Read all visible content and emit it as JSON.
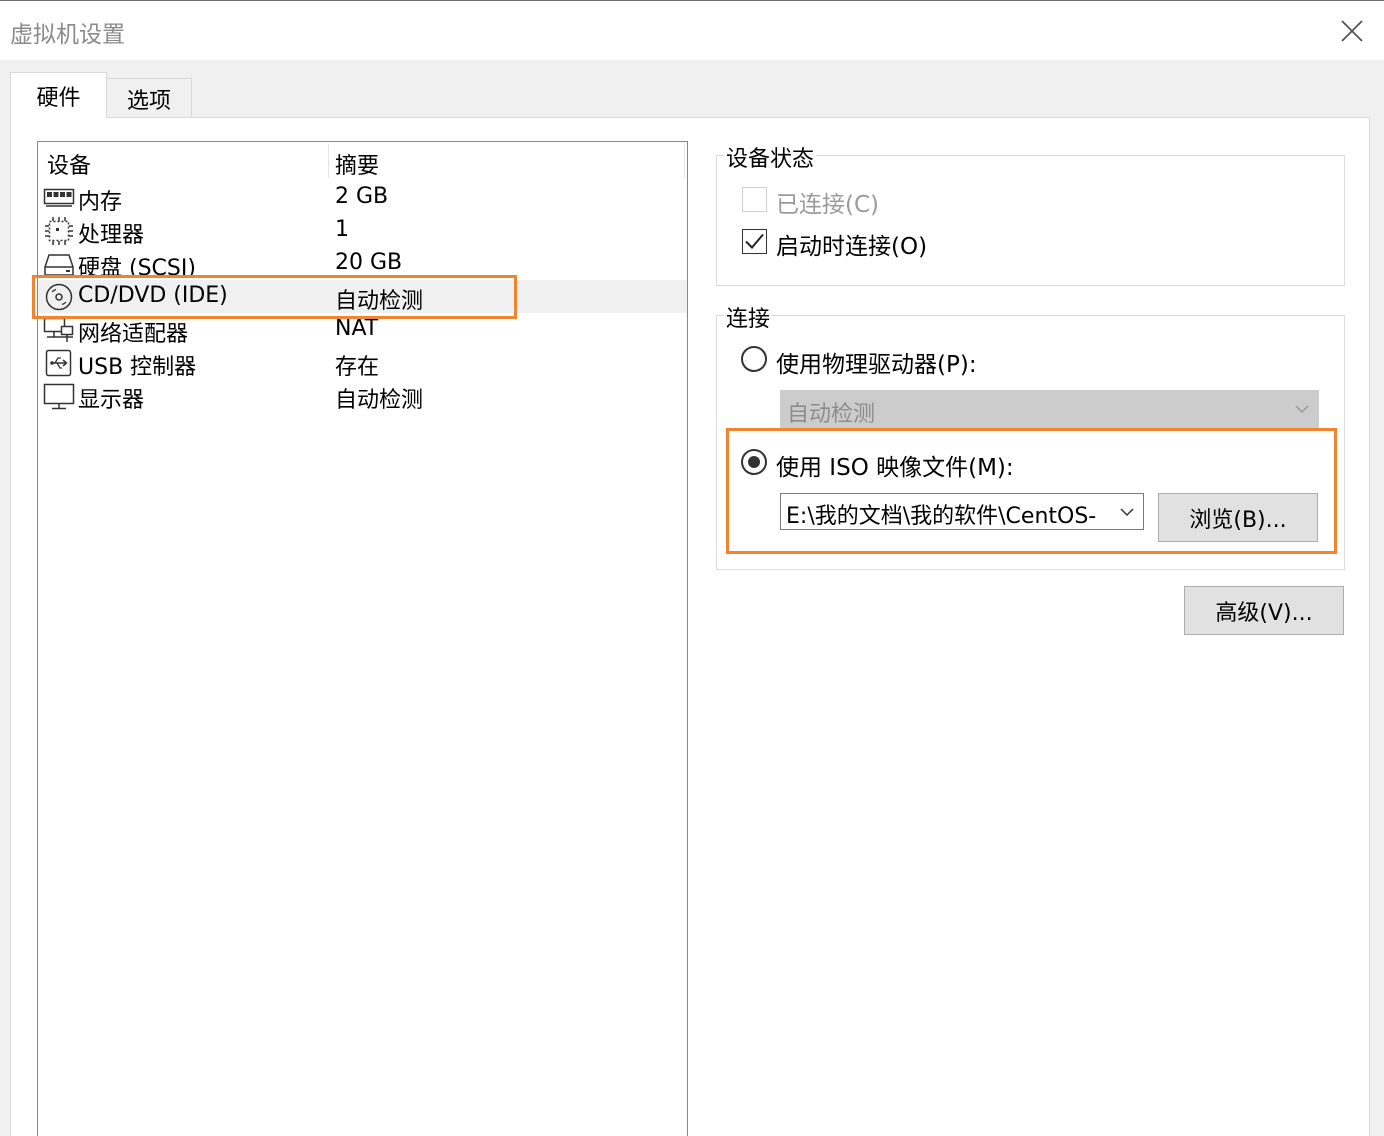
{
  "window": {
    "title": "虚拟机设置"
  },
  "tabs": [
    {
      "label": "硬件",
      "active": true
    },
    {
      "label": "选项",
      "active": false
    }
  ],
  "device_list": {
    "headers": {
      "device": "设备",
      "summary": "摘要"
    },
    "rows": [
      {
        "icon": "memory-icon",
        "name": "内存",
        "summary": "2 GB"
      },
      {
        "icon": "processor-icon",
        "name": "处理器",
        "summary": "1"
      },
      {
        "icon": "hard-disk-icon",
        "name": "硬盘 (SCSI)",
        "summary": "20 GB"
      },
      {
        "icon": "cd-dvd-icon",
        "name": "CD/DVD (IDE)",
        "summary": "自动检测",
        "selected": true
      },
      {
        "icon": "network-adapter-icon",
        "name": "网络适配器",
        "summary": "NAT"
      },
      {
        "icon": "usb-icon",
        "name": "USB 控制器",
        "summary": "存在"
      },
      {
        "icon": "display-icon",
        "name": "显示器",
        "summary": "自动检测"
      }
    ]
  },
  "device_status": {
    "title": "设备状态",
    "connected": {
      "label": "已连接(C)",
      "checked": false,
      "disabled": true
    },
    "connect_at_power_on": {
      "label": "启动时连接(O)",
      "checked": true
    }
  },
  "connection": {
    "title": "连接",
    "physical_drive": {
      "label": "使用物理驱动器(P):",
      "selected": false,
      "dropdown_value": "自动检测"
    },
    "iso_image": {
      "label": "使用 ISO 映像文件(M):",
      "selected": true,
      "path": "E:\\我的文档\\我的软件\\CentOS-",
      "browse_label": "浏览(B)..."
    }
  },
  "advanced_label": "高级(V)...",
  "colors": {
    "highlight": "#f08430",
    "panel": "#ffffff",
    "background": "#f0f0f0"
  }
}
